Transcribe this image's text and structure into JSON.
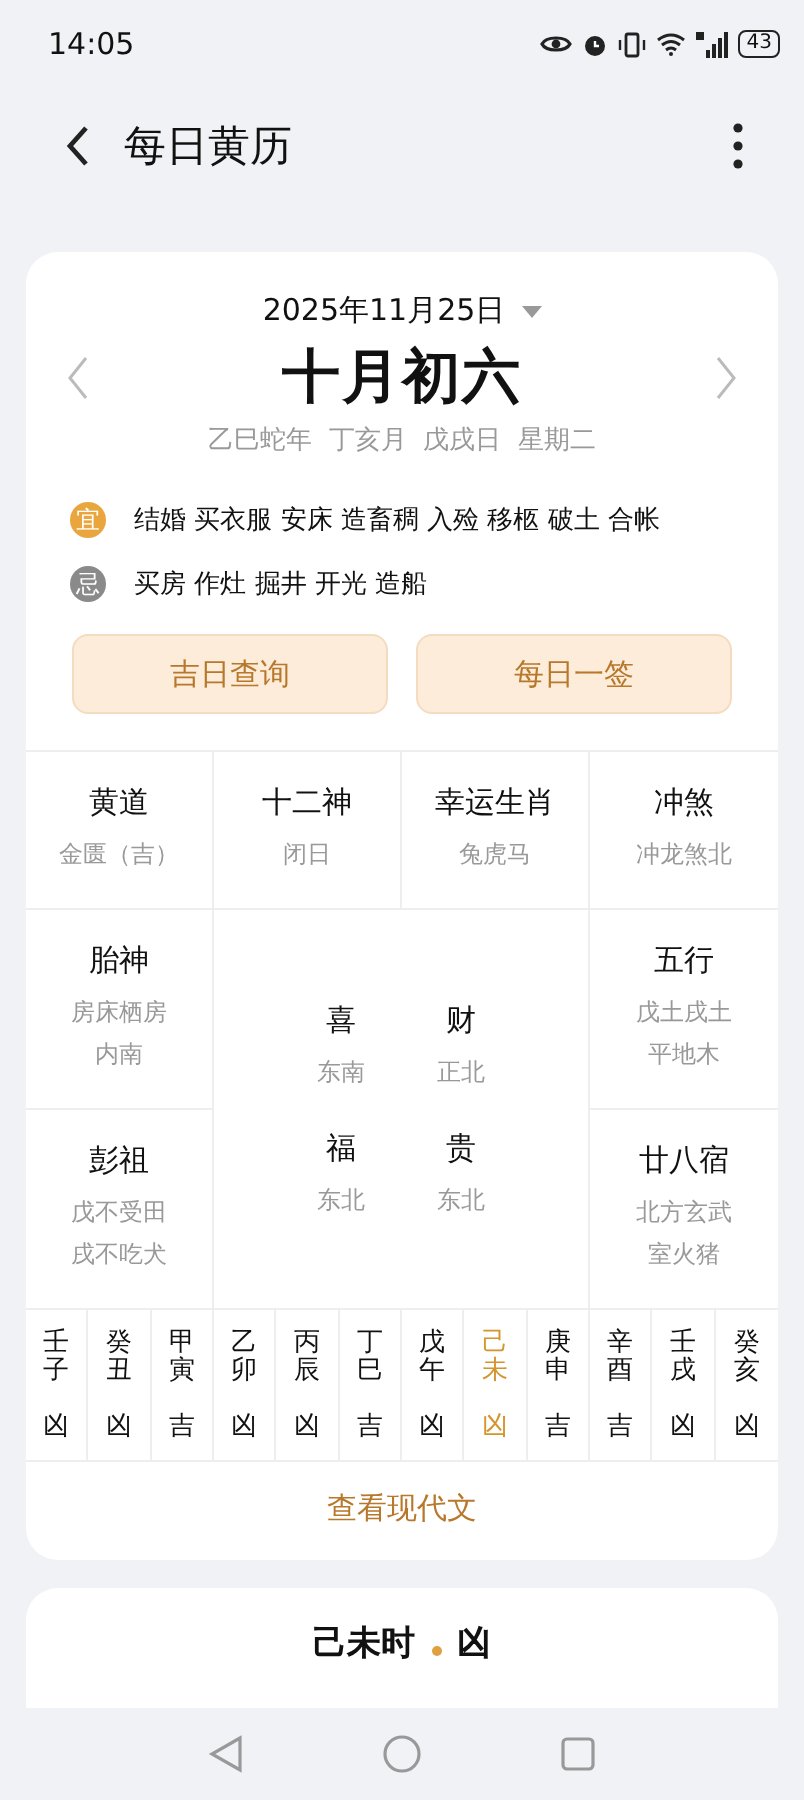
{
  "status_bar": {
    "time": "14:05",
    "battery": "43"
  },
  "header": {
    "title": "每日黄历"
  },
  "calendar": {
    "date": "2025年11月25日",
    "lunar_date": "十月初六",
    "ganzhi": "乙巳蛇年  丁亥月  戊戌日  星期二",
    "advice": [
      {
        "kind": "yi",
        "badge": "宜",
        "text": "结婚 买衣服 安床 造畜稠 入殓 移柩 破土 合帐"
      },
      {
        "kind": "ji",
        "badge": "忌",
        "text": "买房 作灶 掘井 开光 造船"
      }
    ],
    "buttons": [
      "吉日查询",
      "每日一签"
    ],
    "cells": [
      {
        "title": "黄道",
        "lines": [
          "金匮（吉）"
        ]
      },
      {
        "title": "十二神",
        "lines": [
          "闭日"
        ]
      },
      {
        "title": "幸运生肖",
        "lines": [
          "兔虎马"
        ]
      },
      {
        "title": "冲煞",
        "lines": [
          "冲龙煞北"
        ]
      },
      {
        "title": "胎神",
        "lines": [
          "房床栖房",
          "内南"
        ]
      },
      {
        "title": "五行",
        "lines": [
          "戊土戌土",
          "平地木"
        ]
      },
      {
        "title": "彭祖",
        "lines": [
          "戊不受田",
          "戌不吃犬"
        ]
      },
      {
        "title": "廿八宿",
        "lines": [
          "北方玄武",
          "室火猪"
        ]
      }
    ],
    "gods": [
      {
        "title": "喜",
        "direction": "东南"
      },
      {
        "title": "财",
        "direction": "正北"
      },
      {
        "title": "福",
        "direction": "东北"
      },
      {
        "title": "贵",
        "direction": "东北"
      }
    ],
    "hours": [
      {
        "name": "壬子",
        "luck": "凶",
        "selected": false
      },
      {
        "name": "癸丑",
        "luck": "凶",
        "selected": false
      },
      {
        "name": "甲寅",
        "luck": "吉",
        "selected": false
      },
      {
        "name": "乙卯",
        "luck": "凶",
        "selected": false
      },
      {
        "name": "丙辰",
        "luck": "凶",
        "selected": false
      },
      {
        "name": "丁巳",
        "luck": "吉",
        "selected": false
      },
      {
        "name": "戊午",
        "luck": "凶",
        "selected": false
      },
      {
        "name": "己未",
        "luck": "凶",
        "selected": true
      },
      {
        "name": "庚申",
        "luck": "吉",
        "selected": false
      },
      {
        "name": "辛酉",
        "luck": "吉",
        "selected": false
      },
      {
        "name": "壬戌",
        "luck": "凶",
        "selected": false
      },
      {
        "name": "癸亥",
        "luck": "凶",
        "selected": false
      }
    ],
    "link": "查看现代文"
  },
  "hour_card": {
    "title": "己未时",
    "luck": "凶"
  }
}
